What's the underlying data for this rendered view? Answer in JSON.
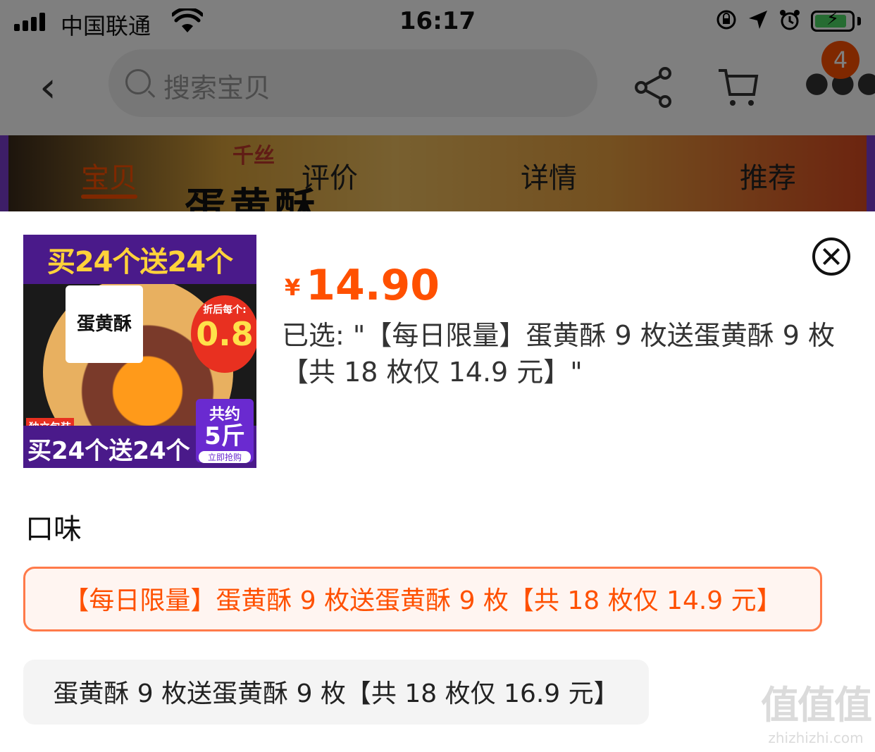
{
  "status_bar": {
    "carrier": "中国联通",
    "time": "16:17"
  },
  "nav": {
    "search_placeholder": "搜索宝贝",
    "cart_badge": "4"
  },
  "hero": {
    "brand": "千丝",
    "title": "蛋黄酥"
  },
  "tabs": [
    {
      "label": "宝贝",
      "active": true
    },
    {
      "label": "评价",
      "active": false
    },
    {
      "label": "详情",
      "active": false
    },
    {
      "label": "推荐",
      "active": false
    }
  ],
  "sheet": {
    "thumbnail": {
      "top_banner": "买24个送24个",
      "box_label": "蛋黄酥",
      "discount_label": "折后每个:",
      "discount_value": "0.8",
      "tag": "独立包装",
      "bottom_banner": "买24个送24个",
      "weight_label": "共约",
      "weight_value": "5斤",
      "buy_now": "立即抢购"
    },
    "price_currency": "¥",
    "price": "14.90",
    "selected_text": "已选: \"【每日限量】蛋黄酥 9 枚送蛋黄酥 9 枚【共 18 枚仅 14.9 元】\"",
    "flavor_title": "口味",
    "options": [
      {
        "label": "【每日限量】蛋黄酥 9 枚送蛋黄酥 9 枚【共 18 枚仅 14.9 元】",
        "selected": true
      },
      {
        "label": "蛋黄酥 9 枚送蛋黄酥 9 枚【共 18 枚仅 16.9 元】",
        "selected": false
      }
    ]
  },
  "watermark": {
    "logo": "值值值",
    "url": "zhizhizhi.com"
  },
  "colors": {
    "accent": "#ff5000",
    "overlay": "rgba(0,0,0,0.5)"
  }
}
